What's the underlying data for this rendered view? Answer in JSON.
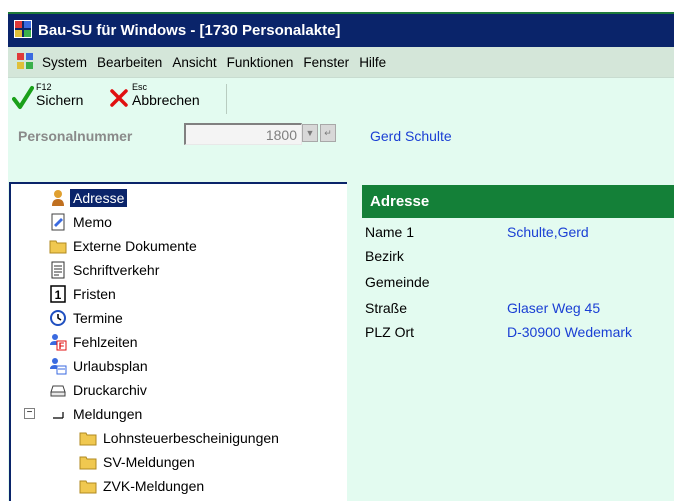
{
  "window": {
    "title": "Bau-SU für Windows - [1730 Personalakte]",
    "app_icon": "puzzle-app-icon"
  },
  "menubar": {
    "items": [
      "System",
      "Bearbeiten",
      "Ansicht",
      "Funktionen",
      "Fenster",
      "Hilfe"
    ]
  },
  "toolbar": {
    "save": {
      "key": "F12",
      "label": "Sichern",
      "icon": "checkmark-icon",
      "color": "#1aa01a"
    },
    "cancel": {
      "key": "Esc",
      "label": "Abbrechen",
      "icon": "x-icon",
      "color": "#e01010"
    }
  },
  "personnel": {
    "label": "Personalnummer",
    "value": "1800",
    "name": "Gerd Schulte"
  },
  "tree": {
    "items": [
      {
        "label": "Adresse",
        "icon": "person-icon",
        "selected": true
      },
      {
        "label": "Memo",
        "icon": "memo-icon"
      },
      {
        "label": "Externe Dokumente",
        "icon": "folder-icon"
      },
      {
        "label": "Schriftverkehr",
        "icon": "document-icon"
      },
      {
        "label": "Fristen",
        "icon": "calendar-1-icon"
      },
      {
        "label": "Termine",
        "icon": "clock-icon"
      },
      {
        "label": "Fehlzeiten",
        "icon": "people-f-icon"
      },
      {
        "label": "Urlaubsplan",
        "icon": "people-icon"
      },
      {
        "label": "Druckarchiv",
        "icon": "printer-icon"
      },
      {
        "label": "Meldungen",
        "icon": "tree-branch-icon",
        "expander": "−"
      },
      {
        "label": "Lohnsteuerbescheinigungen",
        "icon": "folder-icon"
      },
      {
        "label": "SV-Meldungen",
        "icon": "folder-icon"
      },
      {
        "label": "ZVK-Meldungen",
        "icon": "folder-icon"
      }
    ]
  },
  "address": {
    "header": "Adresse",
    "rows": [
      {
        "label": "Name 1",
        "value": "Schulte,Gerd"
      },
      {
        "label": "Bezirk",
        "value": ""
      },
      {
        "label": "Gemeinde",
        "value": ""
      },
      {
        "label": "Straße",
        "value": "Glaser Weg 45"
      },
      {
        "label": "PLZ Ort",
        "value": "D-30900 Wedemark"
      }
    ]
  }
}
